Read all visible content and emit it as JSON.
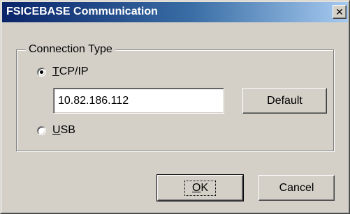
{
  "window": {
    "title": "FSICEBASE Communication",
    "close_glyph": "✕"
  },
  "connection_group": {
    "label": "Connection Type",
    "options": [
      {
        "accel": "T",
        "rest": "CP/IP",
        "selected": true
      },
      {
        "accel": "U",
        "rest": "SB",
        "selected": false
      }
    ],
    "ip_address": "10.82.186.112",
    "default_label": "Default"
  },
  "buttons": {
    "ok_accel": "O",
    "ok_rest": "K",
    "cancel_label": "Cancel"
  },
  "colors": {
    "face": "#d4d0c8",
    "title_start": "#0a246a",
    "title_end": "#a6caf0"
  }
}
